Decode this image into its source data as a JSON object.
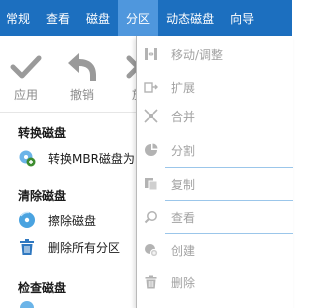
{
  "menubar": {
    "items": [
      {
        "label": "常规"
      },
      {
        "label": "查看"
      },
      {
        "label": "磁盘"
      },
      {
        "label": "分区"
      },
      {
        "label": "动态磁盘"
      },
      {
        "label": "向导"
      }
    ],
    "active_index": 3
  },
  "toolbar": {
    "apply_label": "应用",
    "undo_label": "撤销",
    "discard_label": "放"
  },
  "sidebar": {
    "sections": [
      {
        "title": "转换磁盘",
        "items": [
          {
            "label": "转换MBR磁盘为",
            "icon": "disk-convert-icon"
          }
        ]
      },
      {
        "title": "清除磁盘",
        "items": [
          {
            "label": "擦除磁盘",
            "icon": "wipe-disk-icon"
          },
          {
            "label": "删除所有分区",
            "icon": "trash-icon"
          }
        ]
      },
      {
        "title": "检查磁盘",
        "items": []
      }
    ]
  },
  "dropdown": {
    "items": [
      {
        "label": "移动/调整",
        "icon": "move-resize-icon"
      },
      {
        "label": "扩展",
        "icon": "extend-icon"
      },
      {
        "label": "合并",
        "icon": "merge-icon"
      },
      {
        "label": "分割",
        "icon": "split-icon"
      },
      {
        "label": "复制",
        "icon": "copy-icon"
      },
      {
        "label": "查看",
        "icon": "search-icon"
      },
      {
        "label": "创建",
        "icon": "create-icon"
      },
      {
        "label": "删除",
        "icon": "delete-icon"
      }
    ]
  },
  "colors": {
    "menubar_bg": "#1c6fbf",
    "menubar_active_bg": "#4f97dd",
    "disabled_text": "#a2a2a2",
    "separator": "#9bc6ea"
  }
}
